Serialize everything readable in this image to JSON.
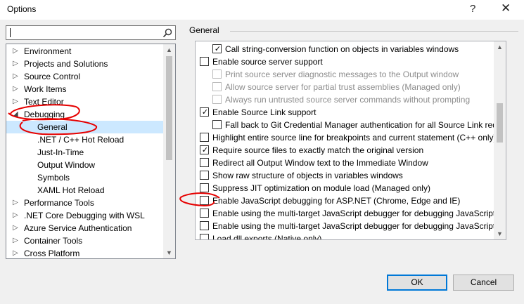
{
  "window": {
    "title": "Options",
    "help_glyph": "?",
    "close_glyph": "✕"
  },
  "search": {
    "value": "",
    "icon": "search-icon"
  },
  "tree": {
    "items": [
      {
        "label": "Environment",
        "level": 0,
        "expanded": false
      },
      {
        "label": "Projects and Solutions",
        "level": 0,
        "expanded": false
      },
      {
        "label": "Source Control",
        "level": 0,
        "expanded": false
      },
      {
        "label": "Work Items",
        "level": 0,
        "expanded": false
      },
      {
        "label": "Text Editor",
        "level": 0,
        "expanded": false
      },
      {
        "label": "Debugging",
        "level": 0,
        "expanded": true
      },
      {
        "label": "General",
        "level": 1,
        "selected": true
      },
      {
        "label": ".NET / C++ Hot Reload",
        "level": 1
      },
      {
        "label": "Just-In-Time",
        "level": 1
      },
      {
        "label": "Output Window",
        "level": 1
      },
      {
        "label": "Symbols",
        "level": 1
      },
      {
        "label": "XAML Hot Reload",
        "level": 1
      },
      {
        "label": "Performance Tools",
        "level": 0,
        "expanded": false
      },
      {
        "label": ".NET Core Debugging with WSL",
        "level": 0,
        "expanded": false
      },
      {
        "label": "Azure Service Authentication",
        "level": 0,
        "expanded": false
      },
      {
        "label": "Container Tools",
        "level": 0,
        "expanded": false
      },
      {
        "label": "Cross Platform",
        "level": 0,
        "expanded": false
      }
    ]
  },
  "section": {
    "title": "General"
  },
  "options": [
    {
      "label": "Call string-conversion function on objects in variables windows",
      "checked": true,
      "disabled": false,
      "level": 1
    },
    {
      "label": "Enable source server support",
      "checked": false,
      "disabled": false,
      "level": 0
    },
    {
      "label": "Print source server diagnostic messages to the Output window",
      "checked": false,
      "disabled": true,
      "level": 1
    },
    {
      "label": "Allow source server for partial trust assemblies (Managed only)",
      "checked": false,
      "disabled": true,
      "level": 1
    },
    {
      "label": "Always run untrusted source server commands without prompting",
      "checked": false,
      "disabled": true,
      "level": 1
    },
    {
      "label": "Enable Source Link support",
      "checked": true,
      "disabled": false,
      "level": 0
    },
    {
      "label": "Fall back to Git Credential Manager authentication for all Source Link requ",
      "checked": false,
      "disabled": false,
      "level": 1
    },
    {
      "label": "Highlight entire source line for breakpoints and current statement (C++ only)",
      "checked": false,
      "disabled": false,
      "level": 0
    },
    {
      "label": "Require source files to exactly match the original version",
      "checked": true,
      "disabled": false,
      "level": 0
    },
    {
      "label": "Redirect all Output Window text to the Immediate Window",
      "checked": false,
      "disabled": false,
      "level": 0
    },
    {
      "label": "Show raw structure of objects in variables windows",
      "checked": false,
      "disabled": false,
      "level": 0
    },
    {
      "label": "Suppress JIT optimization on module load (Managed only)",
      "checked": false,
      "disabled": false,
      "level": 0
    },
    {
      "label": "Enable JavaScript debugging for ASP.NET (Chrome, Edge and IE)",
      "checked": false,
      "disabled": false,
      "level": 0
    },
    {
      "label": "Enable using the multi-target JavaScript debugger for debugging JavaScript i",
      "checked": false,
      "disabled": false,
      "level": 0
    },
    {
      "label": "Enable using the multi-target JavaScript debugger for debugging JavaScript i",
      "checked": false,
      "disabled": false,
      "level": 0
    },
    {
      "label": "Load dll exports (Native only)",
      "checked": false,
      "disabled": false,
      "level": 0
    }
  ],
  "buttons": {
    "ok": "OK",
    "cancel": "Cancel"
  },
  "annotation_color": "#e60000"
}
